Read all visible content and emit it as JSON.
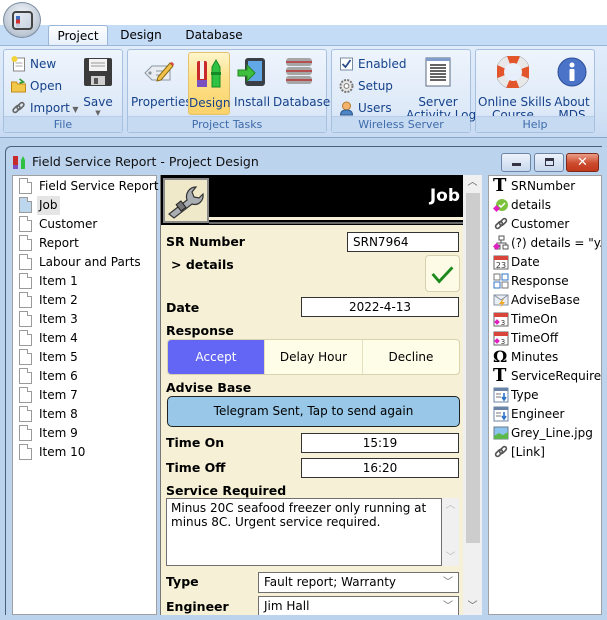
{
  "ribbon": {
    "tabs": [
      {
        "label": "Project",
        "active": true
      },
      {
        "label": "Design",
        "active": false
      },
      {
        "label": "Database",
        "active": false
      }
    ],
    "groups": {
      "file": {
        "title": "File",
        "new": "New",
        "open": "Open",
        "import": "Import",
        "save": "Save"
      },
      "project_tasks": {
        "title": "Project Tasks",
        "properties": "Properties",
        "design": "Design",
        "install": "Install",
        "database": "Database"
      },
      "wireless_server": {
        "title": "Wireless Server",
        "enabled": "Enabled",
        "enabled_checked": true,
        "setup": "Setup",
        "users": "Users",
        "activity_log_line1": "Server",
        "activity_log_line2": "Activity Log"
      },
      "help": {
        "title": "Help",
        "skills_line1": "Online Skills",
        "skills_line2": "Course",
        "about_line1": "About",
        "about_line2": "MDS"
      }
    }
  },
  "window": {
    "title": "Field Service Report - Project Design"
  },
  "pages": [
    {
      "label": "Field Service Report",
      "selected": false
    },
    {
      "label": "Job",
      "selected": true
    },
    {
      "label": "Customer",
      "selected": false
    },
    {
      "label": "Report",
      "selected": false
    },
    {
      "label": "Labour and Parts",
      "selected": false
    },
    {
      "label": "Item 1",
      "selected": false
    },
    {
      "label": "Item 2",
      "selected": false
    },
    {
      "label": "Item 3",
      "selected": false
    },
    {
      "label": "Item 4",
      "selected": false
    },
    {
      "label": "Item 5",
      "selected": false
    },
    {
      "label": "Item 6",
      "selected": false
    },
    {
      "label": "Item 7",
      "selected": false
    },
    {
      "label": "Item 8",
      "selected": false
    },
    {
      "label": "Item 9",
      "selected": false
    },
    {
      "label": "Item 10",
      "selected": false
    }
  ],
  "form": {
    "title": "Job",
    "sr_number_label": "SR Number",
    "sr_number_value": "SRN7964",
    "details_label": "> details",
    "date_label": "Date",
    "date_value": "2022-4-13",
    "response_label": "Response",
    "response_options": [
      "Accept",
      "Delay Hour",
      "Decline"
    ],
    "response_selected": "Accept",
    "advise_base_label": "Advise Base",
    "advise_base_button": "Telegram Sent, Tap to send again",
    "time_on_label": "Time On",
    "time_on_value": "15:19",
    "time_off_label": "Time Off",
    "time_off_value": "16:20",
    "service_required_label": "Service Required",
    "service_required_value": "Minus 20C seafood freezer only running at minus 8C. Urgent service required.",
    "type_label": "Type",
    "type_value": "Fault report; Warranty",
    "engineer_label": "Engineer",
    "engineer_value": "Jim Hall"
  },
  "objects": [
    {
      "label": "SRNumber",
      "icon": "text-icon"
    },
    {
      "label": "details",
      "icon": "check-flag-icon"
    },
    {
      "label": "Customer",
      "icon": "link-icon"
    },
    {
      "label": "(?) details = \"y...",
      "icon": "condition-icon"
    },
    {
      "label": "Date",
      "icon": "calendar-icon"
    },
    {
      "label": "Response",
      "icon": "choice-icon"
    },
    {
      "label": "AdviseBase",
      "icon": "message-icon"
    },
    {
      "label": "TimeOn",
      "icon": "calendar-time-icon"
    },
    {
      "label": "TimeOff",
      "icon": "calendar-time-icon"
    },
    {
      "label": "Minutes",
      "icon": "omega-icon"
    },
    {
      "label": "ServiceRequired",
      "icon": "text-icon"
    },
    {
      "label": "Type",
      "icon": "dropdown-list-icon"
    },
    {
      "label": "Engineer",
      "icon": "dropdown-list-icon"
    },
    {
      "label": "Grey_Line.jpg",
      "icon": "image-icon"
    },
    {
      "label": "[Link]",
      "icon": "link-icon"
    }
  ],
  "colors": {
    "accent_selected": "#6366f4",
    "advise_button": "#98c7e8",
    "form_background": "#f5f0d6",
    "ribbon_text": "#15428b"
  }
}
